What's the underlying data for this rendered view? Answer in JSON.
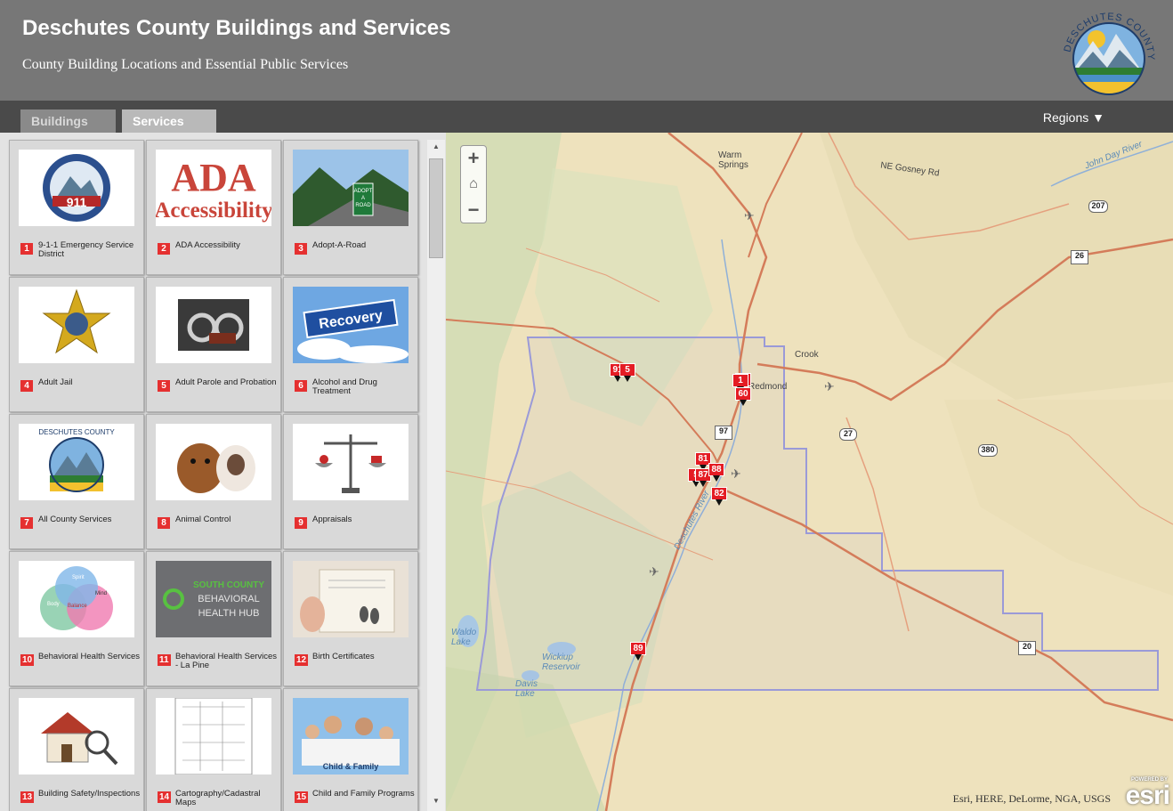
{
  "header": {
    "title": "Deschutes County Buildings and Services",
    "subtitle": "County Building Locations and Essential Public Services",
    "logo_text": "DESCHUTES COUNTY"
  },
  "tabs": {
    "buildings": "Buildings",
    "services": "Services",
    "active": "Services",
    "regions_label": "Regions ▼"
  },
  "services": [
    {
      "num": "1",
      "label": "9-1-1 Emergency Service District",
      "thumb": "911-seal-icon"
    },
    {
      "num": "2",
      "label": "ADA Accessibility",
      "thumb": "ada-text-icon",
      "thumb_text": [
        "ADA",
        "Accessibility"
      ]
    },
    {
      "num": "3",
      "label": "Adopt-A-Road",
      "thumb": "road-sign-photo",
      "thumb_text": [
        "ADOPT",
        "A",
        "ROAD"
      ]
    },
    {
      "num": "4",
      "label": "Adult Jail",
      "thumb": "sheriff-star-icon"
    },
    {
      "num": "5",
      "label": "Adult Parole and Probation",
      "thumb": "handcuffs-photo"
    },
    {
      "num": "6",
      "label": "Alcohol and Drug Treatment",
      "thumb": "recovery-sign-photo",
      "thumb_text": [
        "Recovery"
      ]
    },
    {
      "num": "7",
      "label": "All County Services",
      "thumb": "county-logo-icon",
      "thumb_text": [
        "DESCHUTES COUNTY"
      ]
    },
    {
      "num": "8",
      "label": "Animal Control",
      "thumb": "puppy-kitten-photo"
    },
    {
      "num": "9",
      "label": "Appraisals",
      "thumb": "scale-icon"
    },
    {
      "num": "10",
      "label": "Behavioral Health Services",
      "thumb": "venn-diagram-icon",
      "thumb_text": [
        "Body",
        "Spirit",
        "Mind",
        "Balance"
      ]
    },
    {
      "num": "11",
      "label": "Behavioral Health Services - La Pine",
      "thumb": "health-hub-logo",
      "thumb_text": [
        "SOUTH COUNTY",
        "BEHAVIORAL",
        "HEALTH HUB"
      ]
    },
    {
      "num": "12",
      "label": "Birth Certificates",
      "thumb": "birth-certificate-photo"
    },
    {
      "num": "13",
      "label": "Building Safety/Inspections",
      "thumb": "house-magnifier-icon"
    },
    {
      "num": "14",
      "label": "Cartography/Cadastral Maps",
      "thumb": "cadastral-map-icon"
    },
    {
      "num": "15",
      "label": "Child and Family Programs",
      "thumb": "family-photo",
      "thumb_text": [
        "Child & Family"
      ]
    }
  ],
  "map": {
    "zoom_in": "+",
    "zoom_out": "−",
    "attribution": "Esri, HERE, DeLorme, NGA, USGS",
    "esri_powered": "POWERED BY",
    "esri_brand": "esri",
    "place_labels": [
      "Warm",
      "Springs",
      "NE Gosney Rd",
      "Redmond",
      "Crook",
      "Waldo",
      "Lake",
      "Wickiup",
      "Reservoir",
      "Davis",
      "Lake",
      "Deschutes River",
      "John Day River"
    ],
    "highway_shields": [
      "207",
      "26",
      "97",
      "27",
      "380",
      "20"
    ],
    "markers": [
      "91",
      "5",
      "90",
      "1",
      "60",
      "81",
      "5",
      "87",
      "88",
      "82",
      "89"
    ]
  },
  "colors": {
    "header_bg": "#777777",
    "tabbar_bg": "#4a4a4a",
    "marker": "#e41c24",
    "boundary": "#9a9ad8",
    "road": "#c9644a",
    "map_base": "#eee2bd"
  }
}
